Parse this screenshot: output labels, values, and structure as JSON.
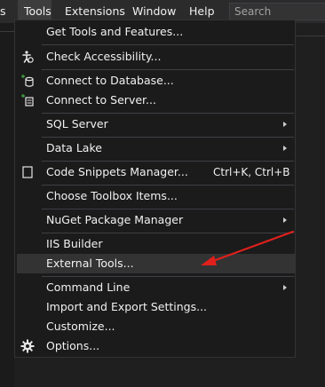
{
  "menubar": {
    "items": [
      {
        "label": "s"
      },
      {
        "label": "Tools"
      },
      {
        "label": "Extensions"
      },
      {
        "label": "Window"
      },
      {
        "label": "Help"
      }
    ],
    "search_placeholder": "Search"
  },
  "tools_menu": {
    "items": [
      {
        "label": "Get Tools and Features..."
      },
      {
        "label": "Check Accessibility...",
        "icon": "accessibility-icon"
      },
      {
        "label": "Connect to Database...",
        "icon": "database-icon"
      },
      {
        "label": "Connect to Server...",
        "icon": "server-icon"
      },
      {
        "label": "SQL Server",
        "submenu": true
      },
      {
        "label": "Data Lake",
        "submenu": true
      },
      {
        "label": "Code Snippets Manager...",
        "shortcut": "Ctrl+K, Ctrl+B",
        "icon": "code-snippets-icon"
      },
      {
        "label": "Choose Toolbox Items..."
      },
      {
        "label": "NuGet Package Manager",
        "submenu": true
      },
      {
        "label": "IIS Builder"
      },
      {
        "label": "External Tools...",
        "highlighted": true
      },
      {
        "label": "Command Line",
        "submenu": true
      },
      {
        "label": "Import and Export Settings..."
      },
      {
        "label": "Customize..."
      },
      {
        "label": "Options...",
        "icon": "gear-icon"
      }
    ]
  },
  "colors": {
    "menu_background": "#1b1b1b",
    "menubar_background": "#2b2b2b",
    "highlight": "#333333",
    "text": "#f1f1f1",
    "annotation_arrow": "#e0201c",
    "accent_green": "#3f9a3f"
  }
}
